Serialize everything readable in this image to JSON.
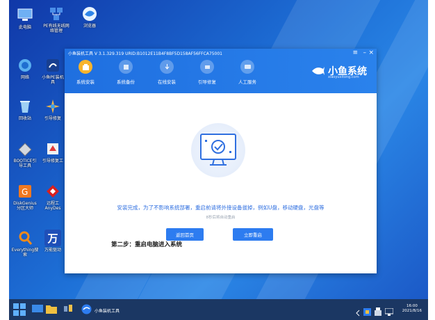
{
  "desktop": {
    "icons": [
      {
        "name": "computer-icon",
        "label": "此电脑",
        "color": "#5aa0e8"
      },
      {
        "name": "pe-network-icon",
        "label": "PE有线无线网\n络管理",
        "color": "#3b7ee0"
      },
      {
        "name": "browser-icon",
        "label": "浏览器",
        "color": "#4a9df0"
      },
      {
        "name": "network-icon",
        "label": "网络",
        "color": "#5ab0f0"
      },
      {
        "name": "xiaoyu-pe-icon",
        "label": "小鱼PE装机\n具",
        "color": "#1d4fa8"
      },
      {
        "name": "recycle-bin-icon",
        "label": "回收站",
        "color": "#8cc8f0"
      },
      {
        "name": "boot-repair-icon",
        "label": "引导修复",
        "color": "#e8a23c"
      },
      {
        "name": "bootice-icon",
        "label": "BOOTICE引\n导工具",
        "color": "#c8ccd4"
      },
      {
        "name": "boot-repair-tool-icon",
        "label": "引导修复工",
        "color": "#e03a3a"
      },
      {
        "name": "diskgenius-icon",
        "label": "DiskGenius\n分区大师",
        "color": "#f07820"
      },
      {
        "name": "remote-tool-icon",
        "label": "远程工\nAnyDes",
        "color": "#d82020"
      },
      {
        "name": "everything-icon",
        "label": "Everything搜\n索",
        "color": "#f08a1a"
      },
      {
        "name": "wanneng-driver-icon",
        "label": "万能驱动",
        "color": "#1f4fb8"
      }
    ]
  },
  "window": {
    "title": "小鱼装机工具 V 3.1.329.319 URID:B1012E11B4F8BF5D158AF56FFCA75001",
    "controls": {
      "menu": "≡",
      "minimize": "–",
      "close": "×"
    },
    "tabs": [
      {
        "label": "系统安装",
        "active": true
      },
      {
        "label": "系统备份",
        "active": false
      },
      {
        "label": "在线安装",
        "active": false
      },
      {
        "label": "引导修复",
        "active": false
      },
      {
        "label": "人工服务",
        "active": false
      }
    ],
    "brand": {
      "name": "小鱼系统",
      "url": "xiaoyuxitong.com"
    },
    "message": "安装完成，为了不影响系统部署，重启前请将外接设备拔掉，例如U盘，移动硬盘，光盘等",
    "countdown": "8秒后将自动重启",
    "buttons": {
      "home": "返回首页",
      "restart": "立即重启"
    },
    "colors": {
      "accent": "#2d7cf0",
      "active_tab": "#f8b42c"
    }
  },
  "overlay_text": "第二步：重启电脑进入系统",
  "taskbar": {
    "app_label": "小鱼装机工具",
    "time": "16:00",
    "date": "2021/8/16"
  }
}
